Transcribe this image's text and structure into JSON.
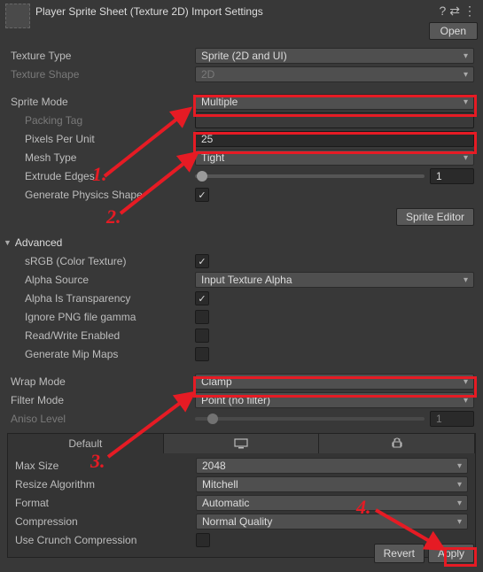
{
  "header": {
    "title": "Player Sprite Sheet (Texture 2D) Import Settings",
    "open_label": "Open"
  },
  "textureType": {
    "label": "Texture Type",
    "value": "Sprite (2D and UI)"
  },
  "textureShape": {
    "label": "Texture Shape",
    "value": "2D"
  },
  "spriteMode": {
    "label": "Sprite Mode",
    "value": "Multiple"
  },
  "packingTag": {
    "label": "Packing Tag"
  },
  "pixelsPerUnit": {
    "label": "Pixels Per Unit",
    "value": "25"
  },
  "meshType": {
    "label": "Mesh Type",
    "value": "Tight"
  },
  "extrudeEdges": {
    "label": "Extrude Edges",
    "value": "1"
  },
  "generatePhysics": {
    "label": "Generate Physics Shape",
    "checked": true
  },
  "spriteEditor": {
    "label": "Sprite Editor"
  },
  "advanced": {
    "label": "Advanced"
  },
  "srgb": {
    "label": "sRGB (Color Texture)",
    "checked": true
  },
  "alphaSource": {
    "label": "Alpha Source",
    "value": "Input Texture Alpha"
  },
  "alphaIsTransparency": {
    "label": "Alpha Is Transparency",
    "checked": true
  },
  "ignorePng": {
    "label": "Ignore PNG file gamma",
    "checked": false
  },
  "readWrite": {
    "label": "Read/Write Enabled",
    "checked": false
  },
  "mipMaps": {
    "label": "Generate Mip Maps",
    "checked": false
  },
  "wrapMode": {
    "label": "Wrap Mode",
    "value": "Clamp"
  },
  "filterMode": {
    "label": "Filter Mode",
    "value": "Point (no filter)"
  },
  "anisoLevel": {
    "label": "Aniso Level",
    "value": "1"
  },
  "platforms": {
    "tab0": "Default"
  },
  "maxSize": {
    "label": "Max Size",
    "value": "2048"
  },
  "resize": {
    "label": "Resize Algorithm",
    "value": "Mitchell"
  },
  "format": {
    "label": "Format",
    "value": "Automatic"
  },
  "compression": {
    "label": "Compression",
    "value": "Normal Quality"
  },
  "crunch": {
    "label": "Use Crunch Compression",
    "checked": false
  },
  "footer": {
    "revert": "Revert",
    "apply": "Apply"
  },
  "annotations": {
    "n1": "1.",
    "n2": "2.",
    "n3": "3.",
    "n4": "4."
  }
}
